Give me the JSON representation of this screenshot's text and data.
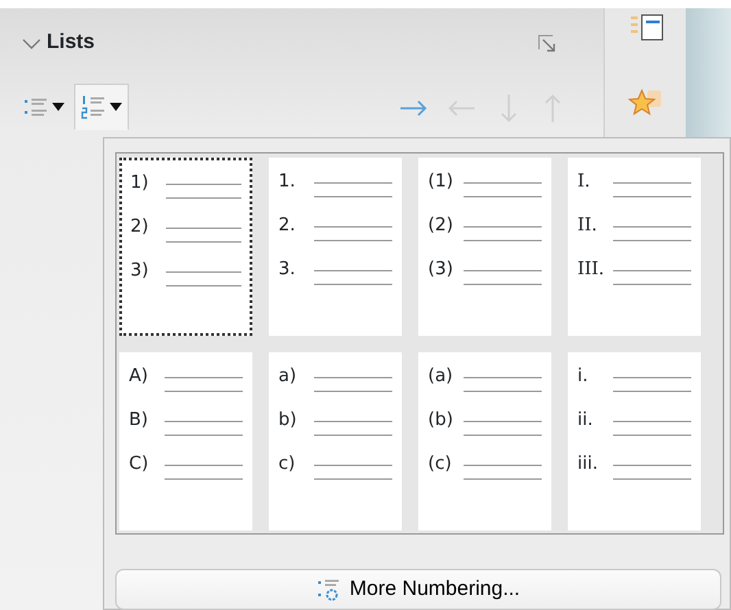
{
  "panel": {
    "title": "Lists",
    "expanded": true
  },
  "toolbar": {
    "bullets_menu": {
      "selected": false
    },
    "numbering_menu": {
      "selected": true
    }
  },
  "numbering_styles": [
    {
      "kind": "plain",
      "selected": true,
      "labels": [
        "1)",
        "2)",
        "3)"
      ]
    },
    {
      "kind": "plain",
      "selected": false,
      "labels": [
        "1.",
        "2.",
        "3."
      ]
    },
    {
      "kind": "plain",
      "selected": false,
      "labels": [
        "(1)",
        "(2)",
        "(3)"
      ]
    },
    {
      "kind": "roman",
      "selected": false,
      "labels": [
        "I.",
        "II.",
        "III."
      ]
    },
    {
      "kind": "plain",
      "selected": false,
      "labels": [
        "A)",
        "B)",
        "C)"
      ]
    },
    {
      "kind": "plain",
      "selected": false,
      "labels": [
        "a)",
        "b)",
        "c)"
      ]
    },
    {
      "kind": "plain",
      "selected": false,
      "labels": [
        "(a)",
        "(b)",
        "(c)"
      ]
    },
    {
      "kind": "plain",
      "selected": false,
      "labels": [
        "i.",
        "ii.",
        "iii."
      ]
    }
  ],
  "more_button": {
    "label": "More Numbering..."
  }
}
